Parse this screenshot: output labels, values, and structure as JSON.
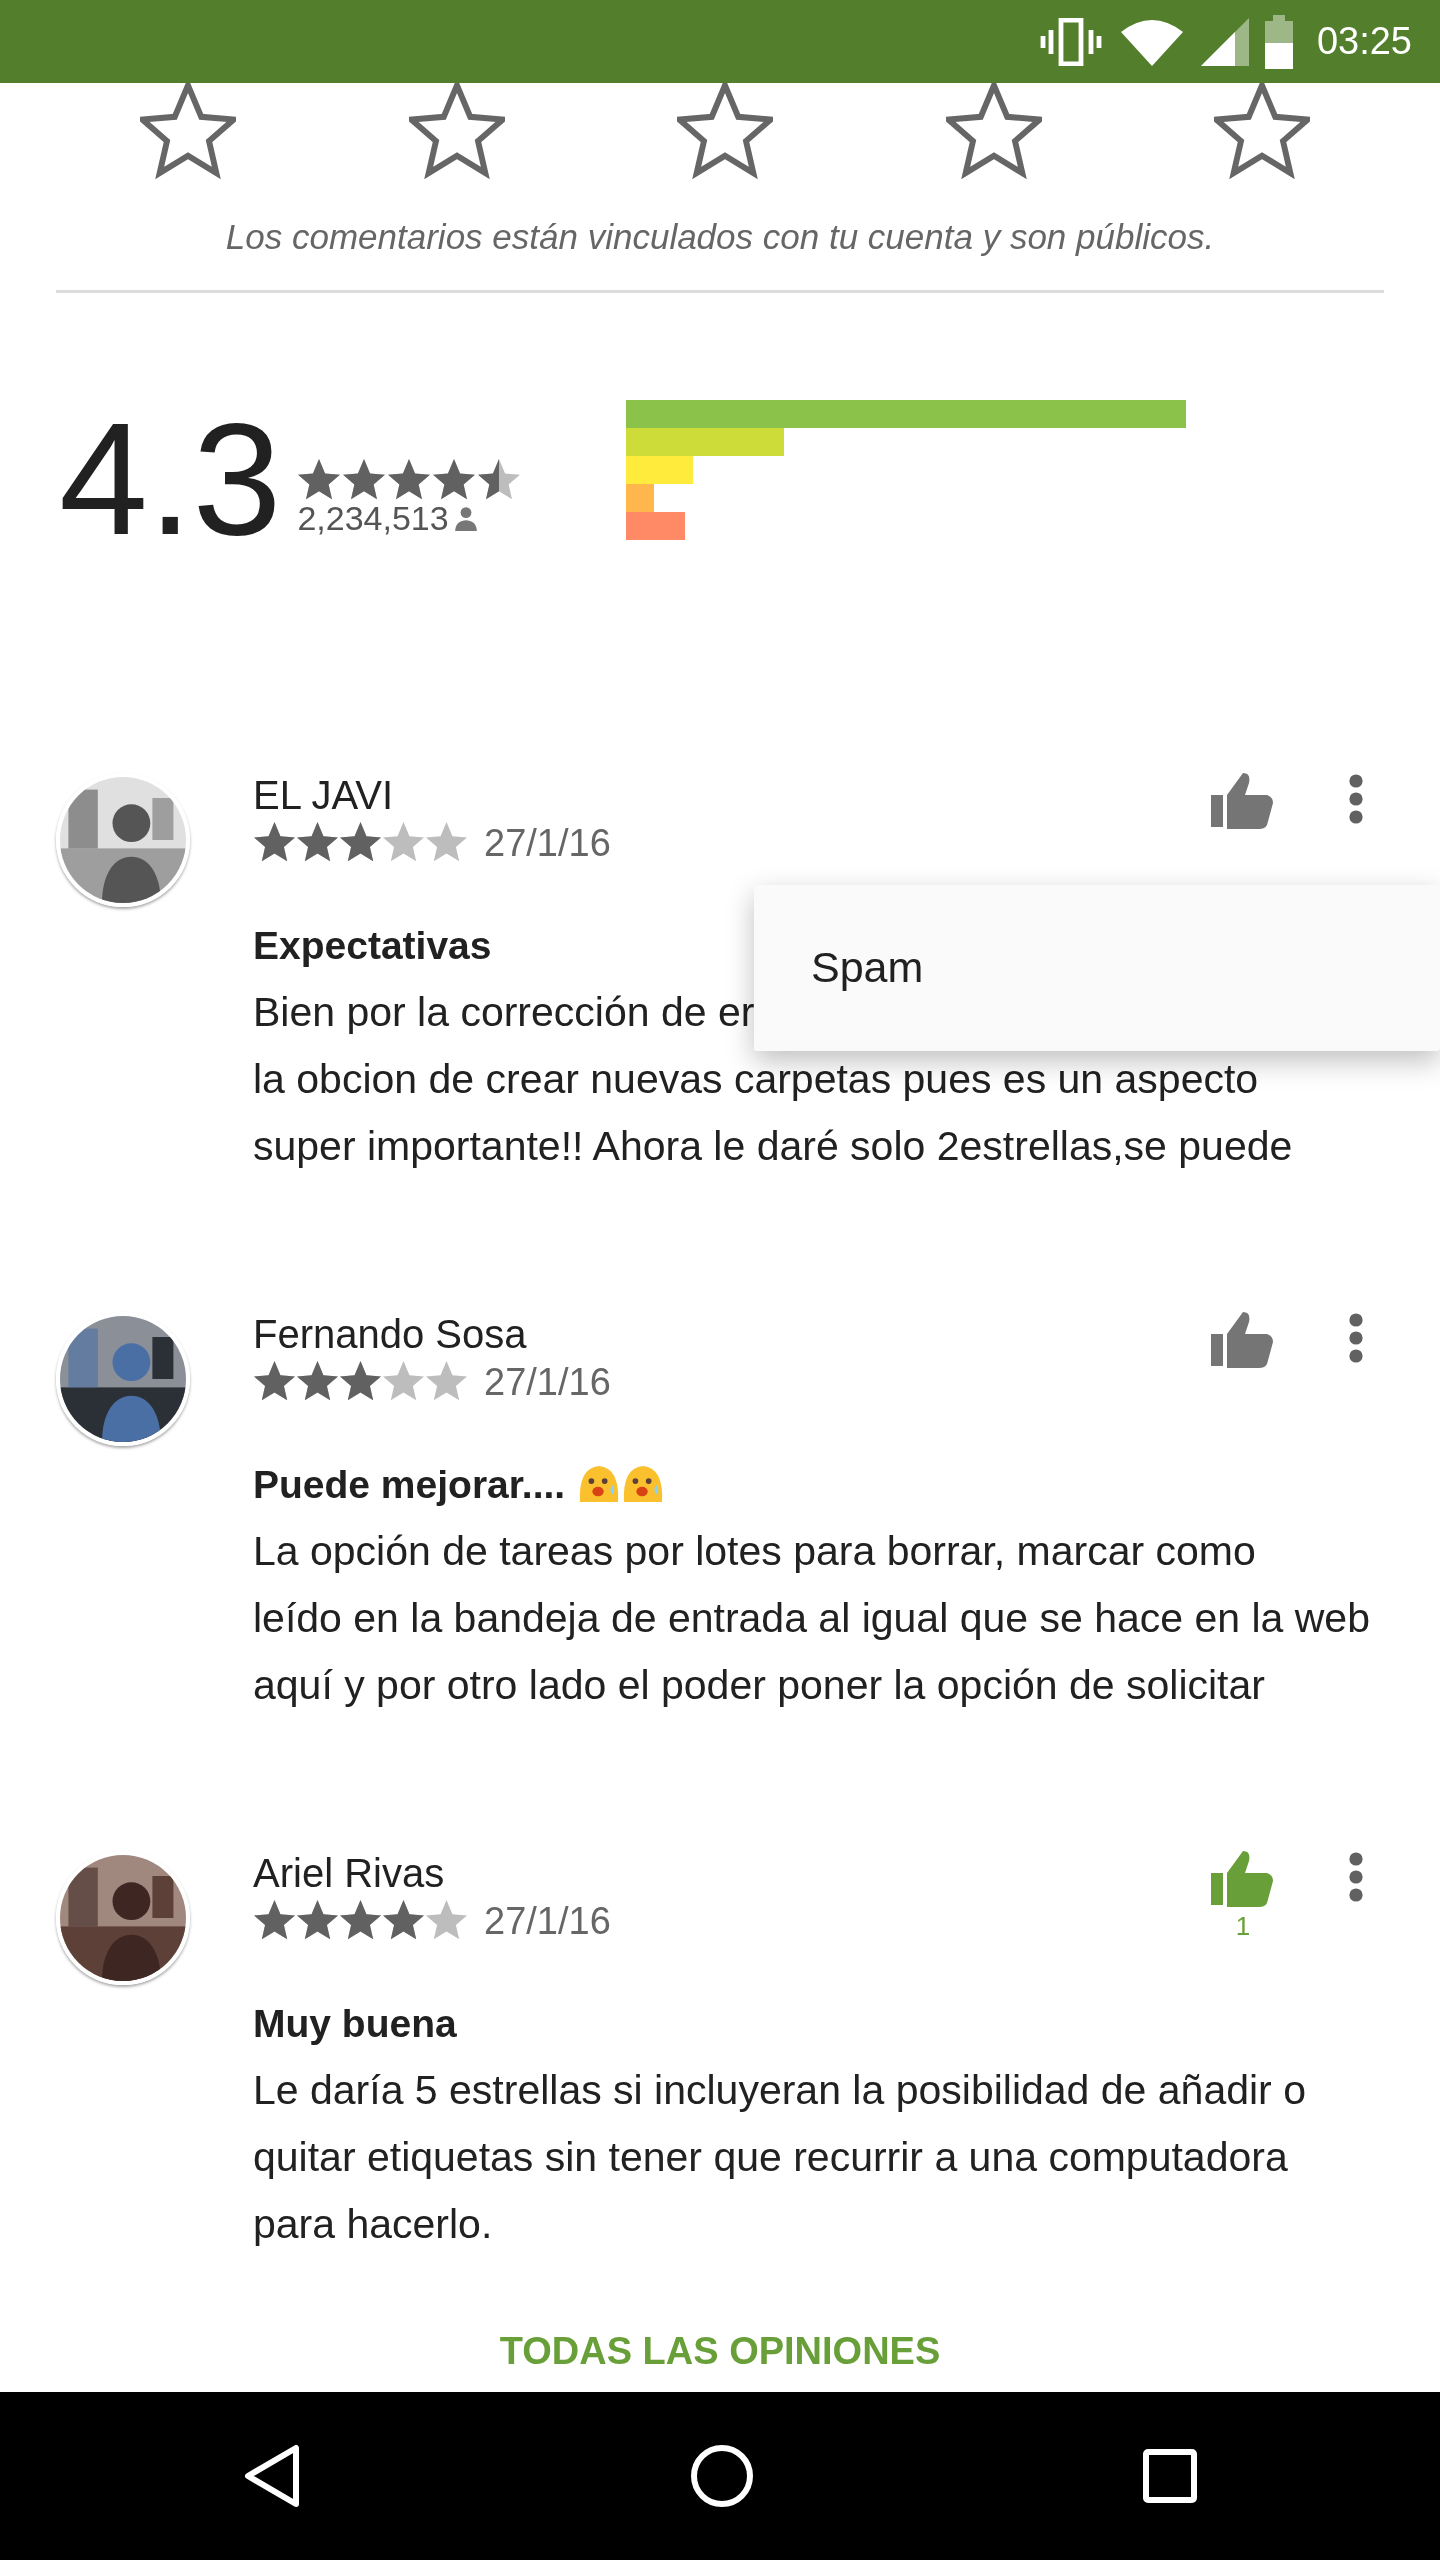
{
  "status_bar": {
    "time": "03:25"
  },
  "rate_prompt": {
    "note": "Los comentarios están vinculados con tu cuenta y son públicos."
  },
  "summary": {
    "rating": "4.3",
    "stars": 4.5,
    "count": "2,234,513"
  },
  "reviews": [
    {
      "author": "EL JAVI",
      "stars": 3,
      "date": "27/1/16",
      "liked": false,
      "title": "Expectativas",
      "lines": [
        "Bien por la corrección de er",
        "la obcion de crear nuevas carpetas pues es un aspecto",
        "super importante!! Ahora le daré solo 2estrellas,se puede"
      ]
    },
    {
      "author": "Fernando Sosa",
      "stars": 3,
      "date": "27/1/16",
      "liked": false,
      "title": "Puede mejorar....",
      "title_icons": [
        {
          "kind": "emoji"
        },
        {
          "kind": "emoji"
        }
      ],
      "lines": [
        "La opción de tareas por lotes para borrar, marcar como",
        "leído en la bandeja de entrada al igual que se hace en la web",
        "aquí y por otro lado el poder poner la opción de solicitar"
      ]
    },
    {
      "author": "Ariel Rivas",
      "stars": 4,
      "date": "27/1/16",
      "liked": true,
      "likes": "1",
      "title": "Muy buena",
      "lines": [
        "Le daría 5 estrellas si incluyeran la posibilidad de añadir o",
        "quitar etiquetas sin tener que recurrir a una computadora",
        "para hacerlo."
      ]
    }
  ],
  "popup_menu": {
    "items": [
      "Spam"
    ]
  },
  "all_reviews_link": "TODAS LAS OPINIONES"
}
